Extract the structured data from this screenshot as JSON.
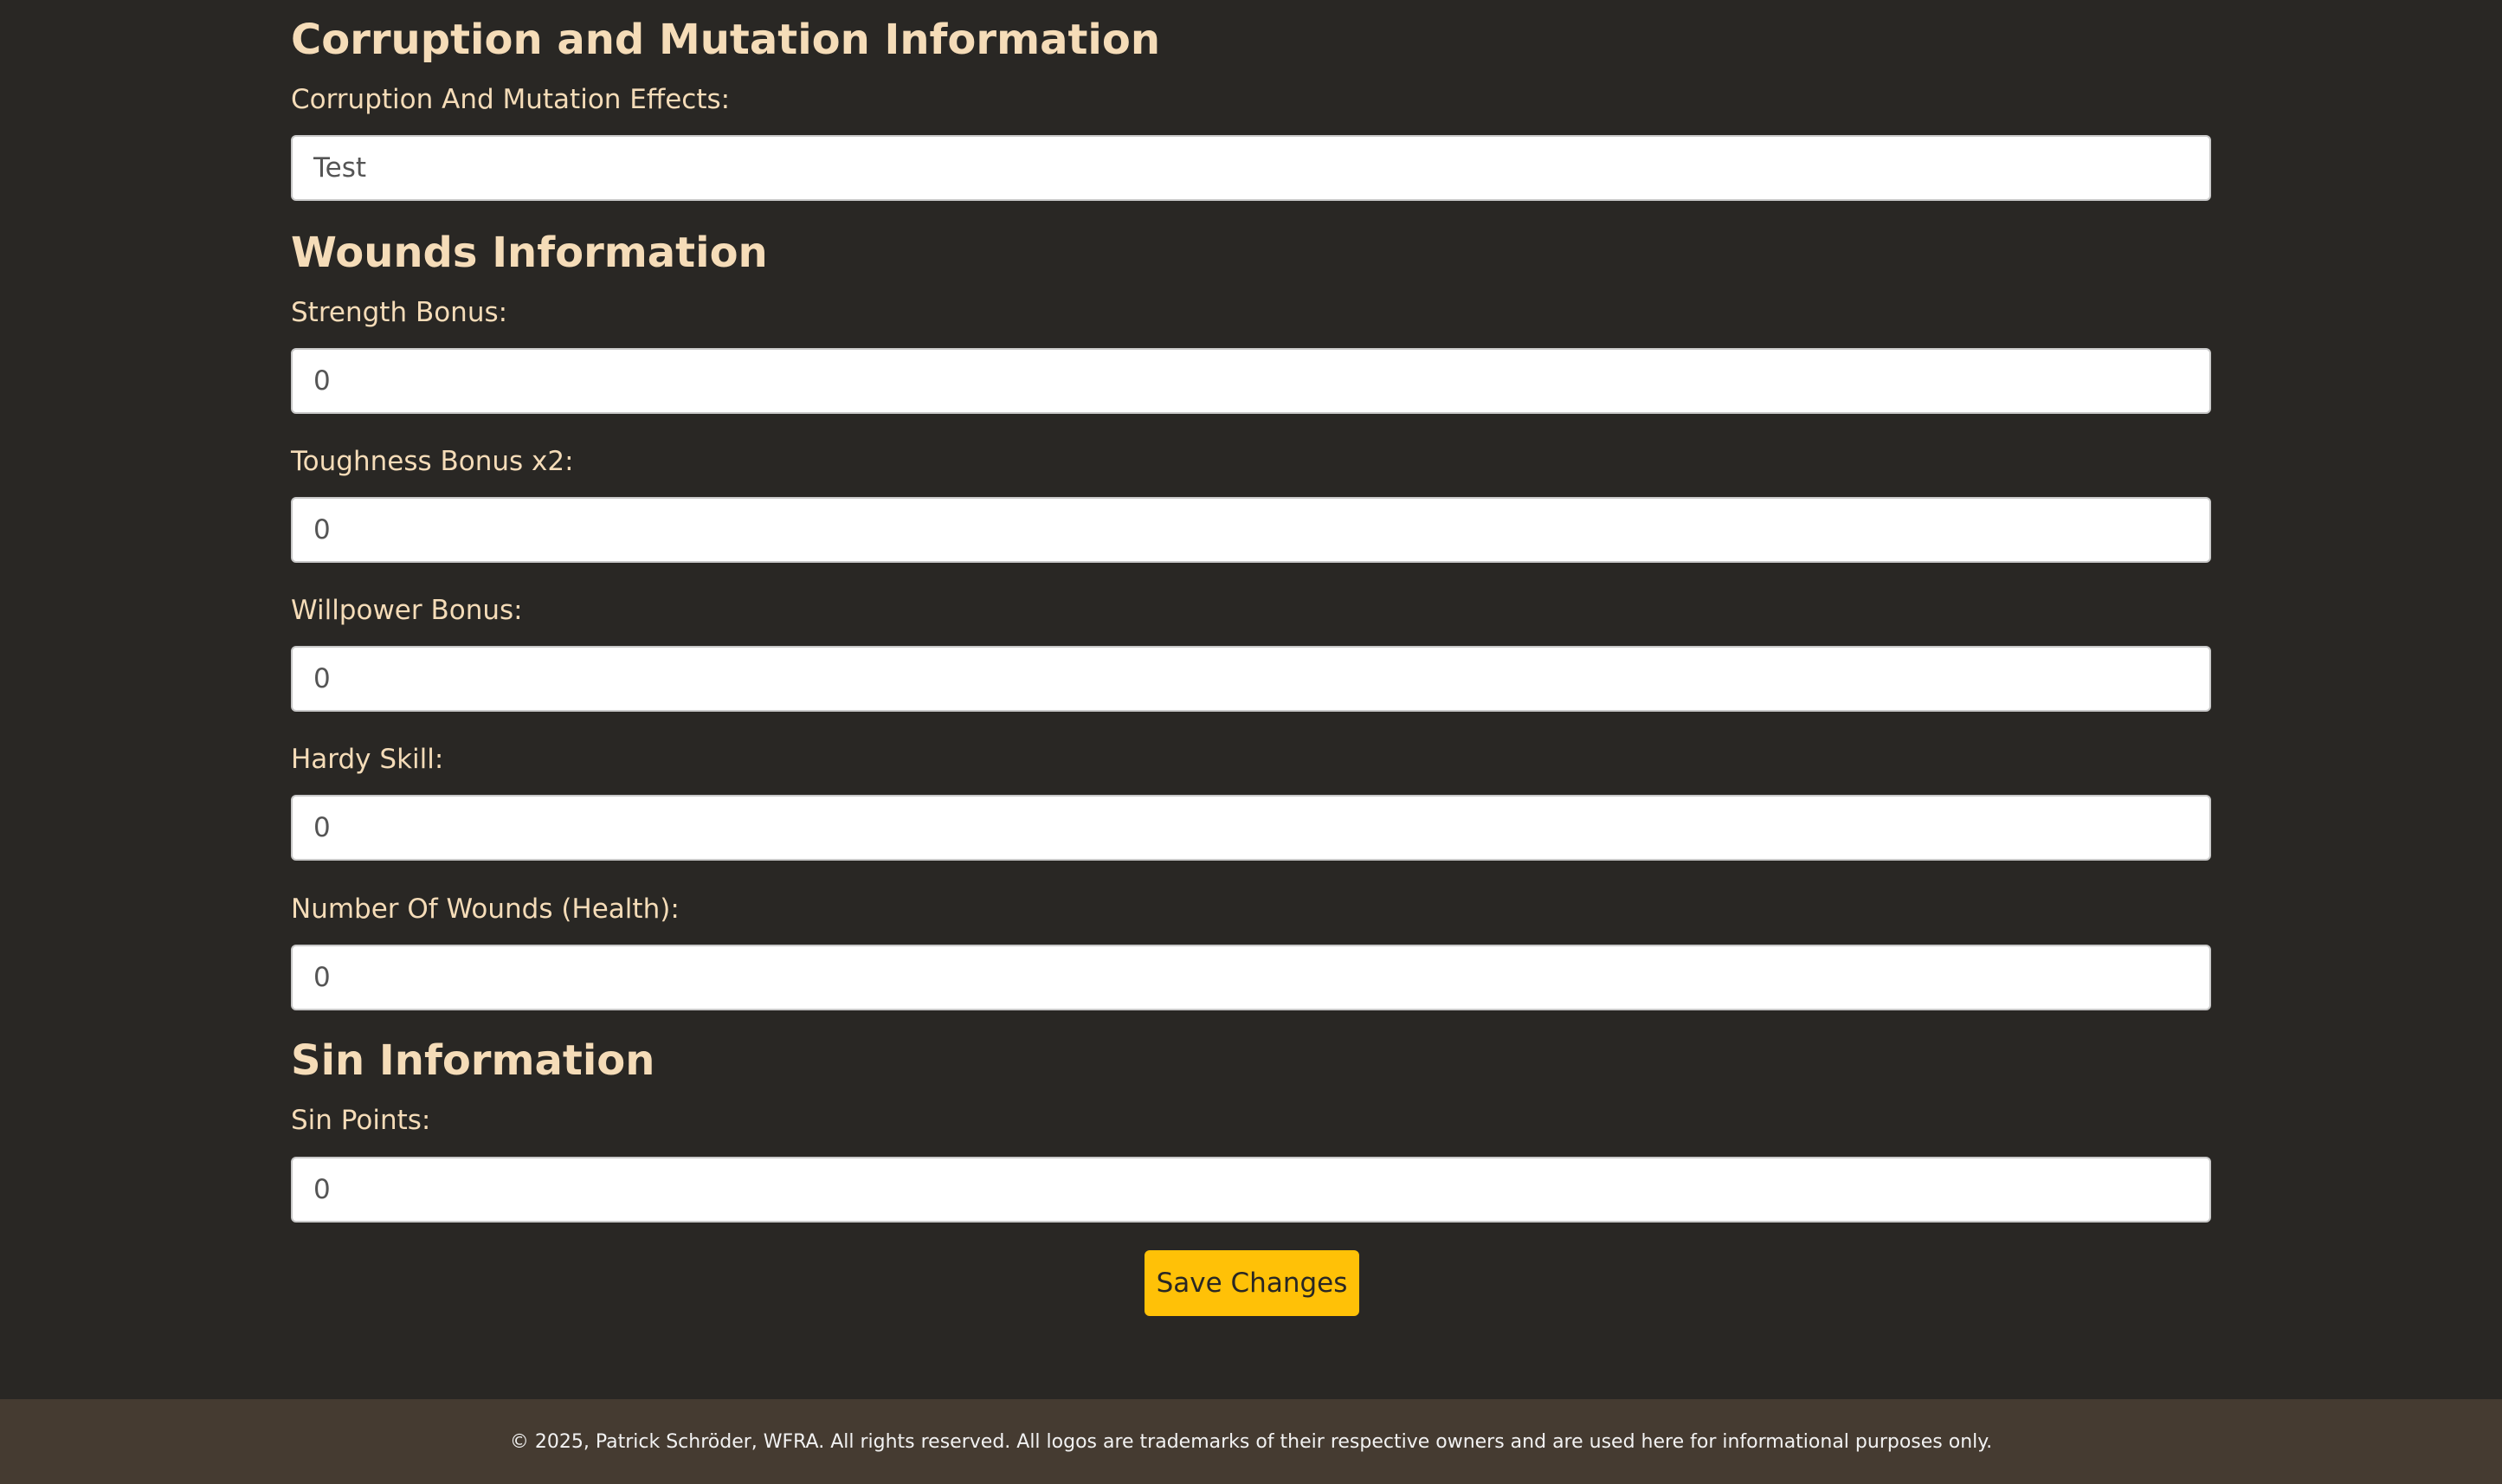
{
  "sections": {
    "corruption": {
      "title": "Corruption and Mutation Information",
      "fields": [
        {
          "label": "Corruption And Mutation Effects:",
          "value": "Test"
        }
      ]
    },
    "wounds": {
      "title": "Wounds Information",
      "fields": [
        {
          "label": "Strength Bonus:",
          "value": "0"
        },
        {
          "label": "Toughness Bonus x2:",
          "value": "0"
        },
        {
          "label": "Willpower Bonus:",
          "value": "0"
        },
        {
          "label": "Hardy Skill:",
          "value": "0"
        },
        {
          "label": "Number Of Wounds (Health):",
          "value": "0"
        }
      ]
    },
    "sin": {
      "title": "Sin Information",
      "fields": [
        {
          "label": "Sin Points:",
          "value": "0"
        }
      ]
    }
  },
  "actions": {
    "save_label": "Save Changes"
  },
  "footer": {
    "text": "© 2025, Patrick Schröder, WFRA. All rights reserved. All logos are trademarks of their respective owners and are used here for informational purposes only."
  },
  "colors": {
    "background": "#292724",
    "heading": "#f5dcb8",
    "accent": "#ffc107",
    "footer_background": "#453b31"
  }
}
